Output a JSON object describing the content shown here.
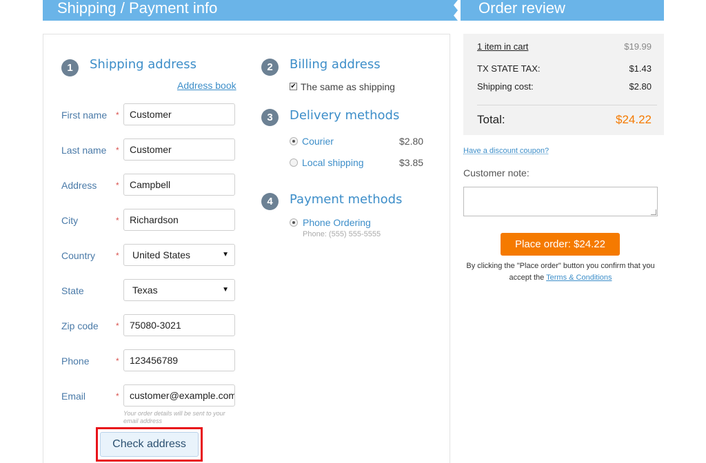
{
  "header": {
    "left_title": "Shipping / Payment info",
    "right_title": "Order review"
  },
  "shipping": {
    "step": "1",
    "title": "Shipping address",
    "address_book": "Address book",
    "fields": [
      {
        "label": "First name",
        "value": "Customer",
        "required": true
      },
      {
        "label": "Last name",
        "value": "Customer",
        "required": true
      },
      {
        "label": "Address",
        "value": "Campbell",
        "required": true
      },
      {
        "label": "City",
        "value": "Richardson",
        "required": true
      },
      {
        "label": "Country",
        "value": "United States",
        "required": true,
        "type": "select"
      },
      {
        "label": "State",
        "value": "Texas",
        "required": false,
        "type": "select"
      },
      {
        "label": "Zip code",
        "value": "75080-3021",
        "required": true
      },
      {
        "label": "Phone",
        "value": "123456789",
        "required": true
      },
      {
        "label": "Email",
        "value": "customer@example.com",
        "required": true
      }
    ],
    "required_mark": "*",
    "email_hint": "Your order details will be sent to your email address",
    "check_address": "Check address"
  },
  "billing": {
    "step": "2",
    "title": "Billing address",
    "same_as_shipping": "The same as shipping",
    "same_checked": true
  },
  "delivery": {
    "step": "3",
    "title": "Delivery methods",
    "options": [
      {
        "label": "Courier",
        "price": "$2.80",
        "selected": true
      },
      {
        "label": "Local shipping",
        "price": "$3.85",
        "selected": false
      }
    ]
  },
  "payment": {
    "step": "4",
    "title": "Payment methods",
    "option": {
      "label": "Phone Ordering",
      "detail": "Phone: (555) 555-5555",
      "selected": true
    }
  },
  "review": {
    "items_in_cart": "1 item in cart",
    "items_total": "$19.99",
    "tax_label": "TX STATE TAX:",
    "tax_value": "$1.43",
    "shipping_label": "Shipping cost:",
    "shipping_value": "$2.80",
    "total_label": "Total:",
    "total_value": "$24.22",
    "coupon": "Have a discount coupon?",
    "note_label": "Customer note:",
    "note_value": "",
    "place_order": "Place order: $24.22",
    "confirm_text": "By clicking the \"Place order\" button you confirm that you accept the",
    "terms": "Terms & Conditions"
  },
  "colors": {
    "header": "#6ab4e8",
    "accent": "#3d8ec9",
    "total": "#f57a00",
    "highlight": "#e8131a"
  }
}
